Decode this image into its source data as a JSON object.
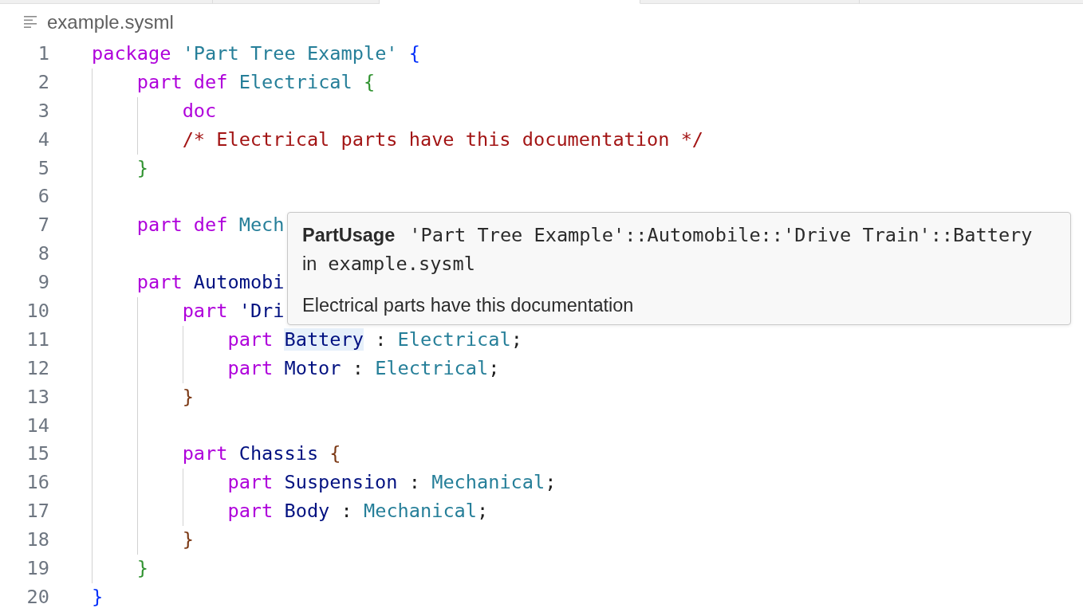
{
  "tabs": [
    {
      "selected": false
    },
    {
      "selected": false
    },
    {
      "selected": true
    },
    {
      "selected": false
    },
    {
      "selected": false
    }
  ],
  "breadcrumb": {
    "file": "example.sysml"
  },
  "code_lines": [
    {
      "number": "1",
      "tokens": [
        {
          "text": "package",
          "kind": "keyword"
        },
        {
          "text": "'Part Tree Example'",
          "kind": "package-name"
        },
        {
          "text": "{",
          "kind": "bracket",
          "color": "#0431fa"
        }
      ],
      "children": [
        {
          "number": "2",
          "tokens": [
            {
              "text": "part",
              "kind": "keyword"
            },
            {
              "text": "def",
              "kind": "keyword"
            },
            {
              "text": "Electrical",
              "kind": "type"
            },
            {
              "text": "{",
              "kind": "bracket",
              "color": "#319331"
            }
          ],
          "children": [
            {
              "number": "3",
              "tokens": [
                {
                  "text": "doc",
                  "kind": "keyword"
                }
              ]
            },
            {
              "number": "4",
              "tokens": [
                {
                  "text": "/* Electrical parts have this documentation */",
                  "kind": "comment"
                }
              ]
            }
          ]
        },
        {
          "number": "5",
          "tokens": [
            {
              "text": "}",
              "kind": "bracket",
              "color": "#319331"
            }
          ]
        },
        {
          "number": "6"
        },
        {
          "number": "7",
          "tokens": [
            {
              "text": "part",
              "kind": "keyword"
            },
            {
              "text": "def",
              "kind": "keyword"
            },
            {
              "text": "Mech",
              "kind": "type"
            }
          ]
        },
        {
          "number": "8"
        },
        {
          "number": "9",
          "tokens": [
            {
              "text": "part",
              "kind": "keyword"
            },
            {
              "text": "Automobi",
              "kind": "name"
            }
          ],
          "children": [
            {
              "number": "10",
              "tokens": [
                {
                  "text": "part",
                  "kind": "keyword"
                },
                {
                  "text": "'Dri",
                  "kind": "name"
                }
              ],
              "children": [
                {
                  "number": "11",
                  "tokens": [
                    {
                      "text": "part",
                      "kind": "keyword"
                    },
                    {
                      "text": "Battery",
                      "kind": "name",
                      "highlighted": true
                    },
                    {
                      "text": ":",
                      "kind": "punct"
                    },
                    {
                      "text": "Electrical",
                      "kind": "type"
                    },
                    {
                      "text": ";",
                      "kind": "punct",
                      "joined": true
                    }
                  ]
                },
                {
                  "number": "12",
                  "tokens": [
                    {
                      "text": "part",
                      "kind": "keyword"
                    },
                    {
                      "text": "Motor",
                      "kind": "name"
                    },
                    {
                      "text": ":",
                      "kind": "punct"
                    },
                    {
                      "text": "Electrical",
                      "kind": "type"
                    },
                    {
                      "text": ";",
                      "kind": "punct",
                      "joined": true
                    }
                  ]
                }
              ]
            },
            {
              "number": "13",
              "tokens": [
                {
                  "text": "}",
                  "kind": "bracket",
                  "color": "#7b3814"
                }
              ]
            },
            {
              "number": "14"
            },
            {
              "number": "15",
              "tokens": [
                {
                  "text": "part",
                  "kind": "keyword"
                },
                {
                  "text": "Chassis",
                  "kind": "name"
                },
                {
                  "text": "{",
                  "kind": "bracket",
                  "color": "#7b3814"
                }
              ],
              "children": [
                {
                  "number": "16",
                  "tokens": [
                    {
                      "text": "part",
                      "kind": "keyword"
                    },
                    {
                      "text": "Suspension",
                      "kind": "name"
                    },
                    {
                      "text": ":",
                      "kind": "punct"
                    },
                    {
                      "text": "Mechanical",
                      "kind": "type"
                    },
                    {
                      "text": ";",
                      "kind": "punct",
                      "joined": true
                    }
                  ]
                },
                {
                  "number": "17",
                  "tokens": [
                    {
                      "text": "part",
                      "kind": "keyword"
                    },
                    {
                      "text": "Body",
                      "kind": "name"
                    },
                    {
                      "text": ":",
                      "kind": "punct"
                    },
                    {
                      "text": "Mechanical",
                      "kind": "type"
                    },
                    {
                      "text": ";",
                      "kind": "punct",
                      "joined": true
                    }
                  ]
                }
              ]
            },
            {
              "number": "18",
              "tokens": [
                {
                  "text": "}",
                  "kind": "bracket",
                  "color": "#7b3814"
                }
              ]
            }
          ]
        },
        {
          "number": "19",
          "tokens": [
            {
              "text": "}",
              "kind": "bracket",
              "color": "#319331"
            }
          ]
        }
      ]
    },
    {
      "number": "20",
      "tokens": [
        {
          "text": "}",
          "kind": "bracket",
          "color": "#0431fa"
        }
      ]
    }
  ],
  "hover": {
    "kind_label": "PartUsage",
    "qualified_name": "'Part Tree Example'::Automobile::'Drive Train'::Battery",
    "in_label": "in",
    "file": "example.sysml",
    "documentation": "Electrical parts have this documentation"
  }
}
